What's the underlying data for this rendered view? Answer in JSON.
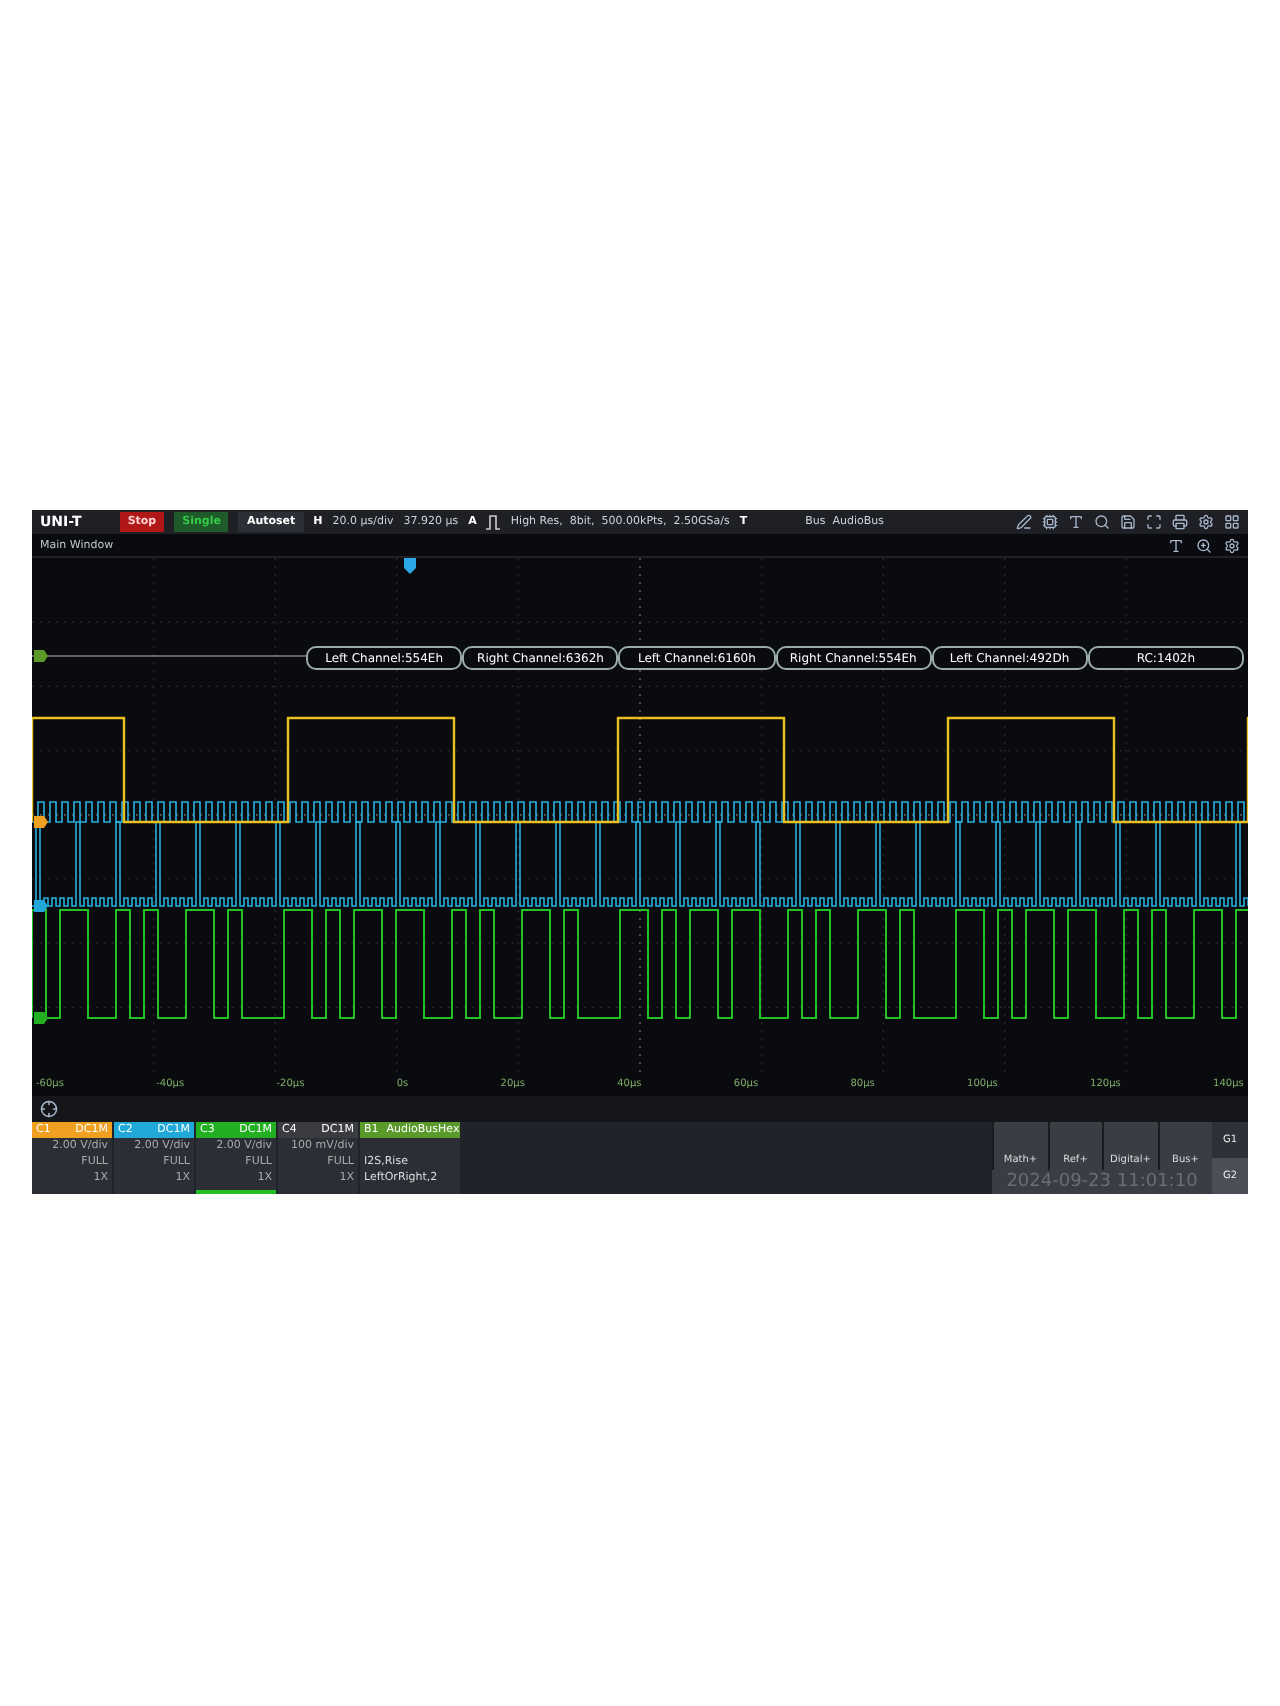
{
  "top_bar": {
    "logo": "UNI-T",
    "run_state": "Stop",
    "mode": "Single",
    "autoset": "Autoset",
    "horizontal": {
      "label": "H",
      "scale": "20.0 μs/div",
      "offset": "37.920 μs"
    },
    "acquire": {
      "label": "A",
      "info": "High Res,  8bit,  500.00kPts,  2.50GSa/s"
    },
    "trigger": {
      "label": "T",
      "source": "Bus  AudioBus"
    }
  },
  "window_title": "Main Window",
  "decode": [
    "Left Channel:554Eh",
    "Right Channel:6362h",
    "Left Channel:6160h",
    "Right Channel:554Eh",
    "Left Channel:492Dh",
    "RC:1402h"
  ],
  "x_axis": [
    "-60μs",
    "-40μs",
    "-20μs",
    "0s",
    "20μs",
    "40μs",
    "60μs",
    "80μs",
    "100μs",
    "120μs",
    "140μs"
  ],
  "channels": [
    {
      "name": "C1",
      "coupling": "DC1M",
      "scale": "2.00 V/div",
      "bandwidth": "FULL",
      "probe": "1X",
      "color": "#f0a020",
      "selected": false
    },
    {
      "name": "C2",
      "coupling": "DC1M",
      "scale": "2.00 V/div",
      "bandwidth": "FULL",
      "probe": "1X",
      "color": "#20a8d8",
      "selected": false
    },
    {
      "name": "C3",
      "coupling": "DC1M",
      "scale": "2.00 V/div",
      "bandwidth": "FULL",
      "probe": "1X",
      "color": "#22b022",
      "selected": true
    },
    {
      "name": "C4",
      "coupling": "DC1M",
      "scale": "100 mV/div",
      "bandwidth": "FULL",
      "probe": "1X",
      "color": "#3a3c42",
      "selected": false
    }
  ],
  "bus": {
    "name": "B1",
    "title": "AudioBusHex",
    "lines": [
      "I2S,Rise",
      "LeftOrRight,2"
    ]
  },
  "buttons": [
    "Math+",
    "Ref+",
    "Digital+",
    "Bus+"
  ],
  "groups": [
    {
      "label": "G1",
      "selected": false
    },
    {
      "label": "G2",
      "selected": true
    }
  ],
  "timestamp": "2024-09-23 11:01:10"
}
